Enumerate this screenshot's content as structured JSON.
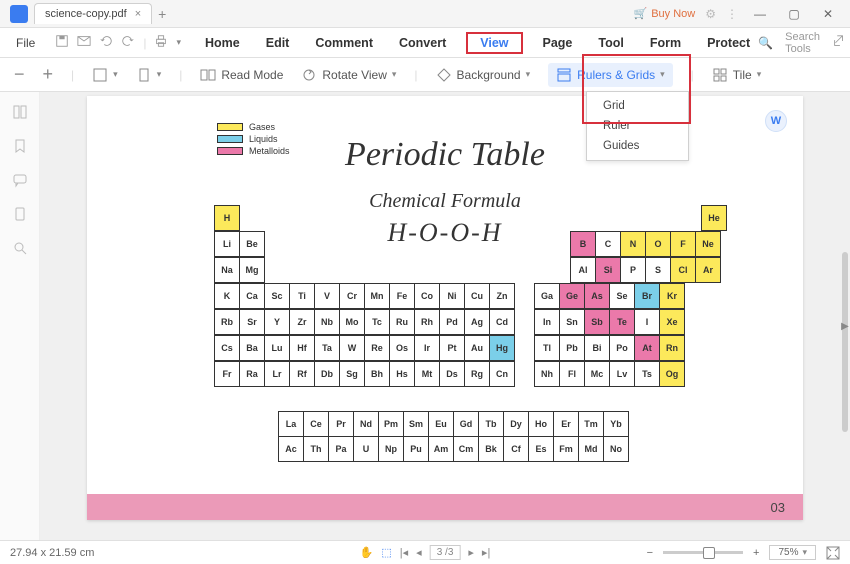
{
  "titlebar": {
    "filename": "science-copy.pdf",
    "buy_label": "Buy Now"
  },
  "menu": {
    "file": "File",
    "tabs": [
      "Home",
      "Edit",
      "Comment",
      "Convert",
      "View",
      "Page",
      "Tool",
      "Form",
      "Protect"
    ],
    "search_placeholder": "Search Tools"
  },
  "toolbar": {
    "read_mode": "Read Mode",
    "rotate_view": "Rotate View",
    "background": "Background",
    "rulers_grids": "Rulers & Grids",
    "tile": "Tile",
    "minus": "−",
    "plus": "+",
    "rulers_menu": [
      "Grid",
      "Ruler",
      "Guides"
    ]
  },
  "document": {
    "title": "Periodic Table",
    "subtitle": "Chemical Formula",
    "formula": "H-O-O-H",
    "legend": {
      "gases": "Gases",
      "liquids": "Liquids",
      "metalloids": "Metalloids"
    },
    "page_num": "03"
  },
  "statusbar": {
    "dims": "27.94 x 21.59 cm",
    "page_field": "3 /3",
    "zoom": "75%",
    "minus": "−",
    "plus": "+"
  },
  "pt": {
    "main": [
      [
        {
          "s": "H",
          "c": "y"
        },
        null,
        null,
        null,
        null,
        null,
        null,
        null,
        null,
        null,
        null,
        null,
        null,
        null,
        null,
        null,
        null,
        {
          "s": "He",
          "c": "y"
        }
      ],
      [
        {
          "s": "Li"
        },
        {
          "s": "Be"
        },
        null,
        null,
        null,
        null,
        null,
        null,
        null,
        null,
        null,
        null,
        {
          "s": "B",
          "c": "p"
        },
        {
          "s": "C"
        },
        {
          "s": "N",
          "c": "y"
        },
        {
          "s": "O",
          "c": "y"
        },
        {
          "s": "F",
          "c": "y"
        },
        {
          "s": "Ne",
          "c": "y"
        }
      ],
      [
        {
          "s": "Na"
        },
        {
          "s": "Mg"
        },
        null,
        null,
        null,
        null,
        null,
        null,
        null,
        null,
        null,
        null,
        {
          "s": "Al"
        },
        {
          "s": "Si",
          "c": "p"
        },
        {
          "s": "P"
        },
        {
          "s": "S"
        },
        {
          "s": "Cl",
          "c": "y"
        },
        {
          "s": "Ar",
          "c": "y"
        }
      ],
      [
        {
          "s": "K"
        },
        {
          "s": "Ca"
        },
        {
          "s": "Sc"
        },
        {
          "s": "Ti"
        },
        {
          "s": "V"
        },
        {
          "s": "Cr"
        },
        {
          "s": "Mn"
        },
        {
          "s": "Fe"
        },
        {
          "s": "Co"
        },
        {
          "s": "Ni"
        },
        {
          "s": "Cu"
        },
        {
          "s": "Zn"
        },
        {
          "s": "Ga"
        },
        {
          "s": "Ge",
          "c": "p"
        },
        {
          "s": "As",
          "c": "p"
        },
        {
          "s": "Se"
        },
        {
          "s": "Br",
          "c": "b"
        },
        {
          "s": "Kr",
          "c": "y"
        }
      ],
      [
        {
          "s": "Rb"
        },
        {
          "s": "Sr"
        },
        {
          "s": "Y"
        },
        {
          "s": "Zr"
        },
        {
          "s": "Nb"
        },
        {
          "s": "Mo"
        },
        {
          "s": "Tc"
        },
        {
          "s": "Ru"
        },
        {
          "s": "Rh"
        },
        {
          "s": "Pd"
        },
        {
          "s": "Ag"
        },
        {
          "s": "Cd"
        },
        {
          "s": "In"
        },
        {
          "s": "Sn"
        },
        {
          "s": "Sb",
          "c": "p"
        },
        {
          "s": "Te",
          "c": "p"
        },
        {
          "s": "I"
        },
        {
          "s": "Xe",
          "c": "y"
        }
      ],
      [
        {
          "s": "Cs"
        },
        {
          "s": "Ba"
        },
        {
          "s": "Lu"
        },
        {
          "s": "Hf"
        },
        {
          "s": "Ta"
        },
        {
          "s": "W"
        },
        {
          "s": "Re"
        },
        {
          "s": "Os"
        },
        {
          "s": "Ir"
        },
        {
          "s": "Pt"
        },
        {
          "s": "Au"
        },
        {
          "s": "Hg",
          "c": "b"
        },
        {
          "s": "Tl"
        },
        {
          "s": "Pb"
        },
        {
          "s": "Bi"
        },
        {
          "s": "Po"
        },
        {
          "s": "At",
          "c": "p"
        },
        {
          "s": "Rn",
          "c": "y"
        }
      ],
      [
        {
          "s": "Fr"
        },
        {
          "s": "Ra"
        },
        {
          "s": "Lr"
        },
        {
          "s": "Rf"
        },
        {
          "s": "Db"
        },
        {
          "s": "Sg"
        },
        {
          "s": "Bh"
        },
        {
          "s": "Hs"
        },
        {
          "s": "Mt"
        },
        {
          "s": "Ds"
        },
        {
          "s": "Rg"
        },
        {
          "s": "Cn"
        },
        {
          "s": "Nh"
        },
        {
          "s": "Fl"
        },
        {
          "s": "Mc"
        },
        {
          "s": "Lv"
        },
        {
          "s": "Ts"
        },
        {
          "s": "Og",
          "c": "y"
        }
      ]
    ],
    "la": [
      "La",
      "Ce",
      "Pr",
      "Nd",
      "Pm",
      "Sm",
      "Eu",
      "Gd",
      "Tb",
      "Dy",
      "Ho",
      "Er",
      "Tm",
      "Yb"
    ],
    "ac": [
      "Ac",
      "Th",
      "Pa",
      "U",
      "Np",
      "Pu",
      "Am",
      "Cm",
      "Bk",
      "Cf",
      "Es",
      "Fm",
      "Md",
      "No"
    ]
  }
}
